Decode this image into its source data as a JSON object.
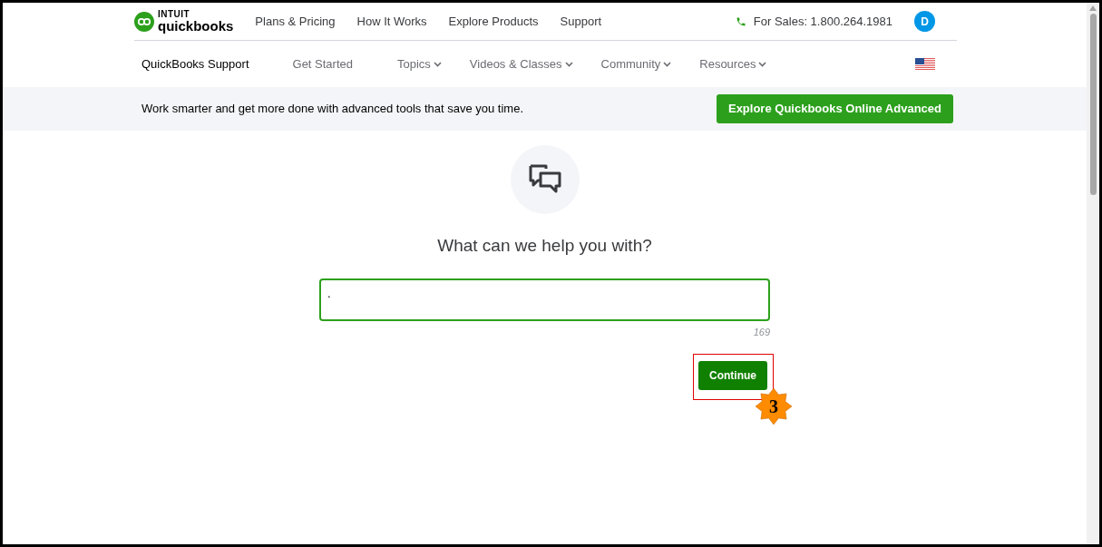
{
  "header": {
    "logo": {
      "top": "INTUIT",
      "bottom": "quickbooks"
    },
    "nav": [
      "Plans & Pricing",
      "How It Works",
      "Explore Products",
      "Support"
    ],
    "sales": "For Sales: 1.800.264.1981",
    "avatar": "D"
  },
  "subnav": {
    "title": "QuickBooks Support",
    "items": [
      {
        "label": "Get Started",
        "dropdown": false
      },
      {
        "label": "Topics",
        "dropdown": true
      },
      {
        "label": "Videos & Classes",
        "dropdown": true
      },
      {
        "label": "Community",
        "dropdown": true
      },
      {
        "label": "Resources",
        "dropdown": true
      }
    ]
  },
  "banner": {
    "text": "Work smarter and get more done with advanced tools that save you time.",
    "button": "Explore Quickbooks Online Advanced"
  },
  "main": {
    "heading": "What can we help you with?",
    "field": {
      "value": "."
    },
    "counter": "169",
    "button": "Continue"
  },
  "annotation": {
    "label": "3"
  }
}
